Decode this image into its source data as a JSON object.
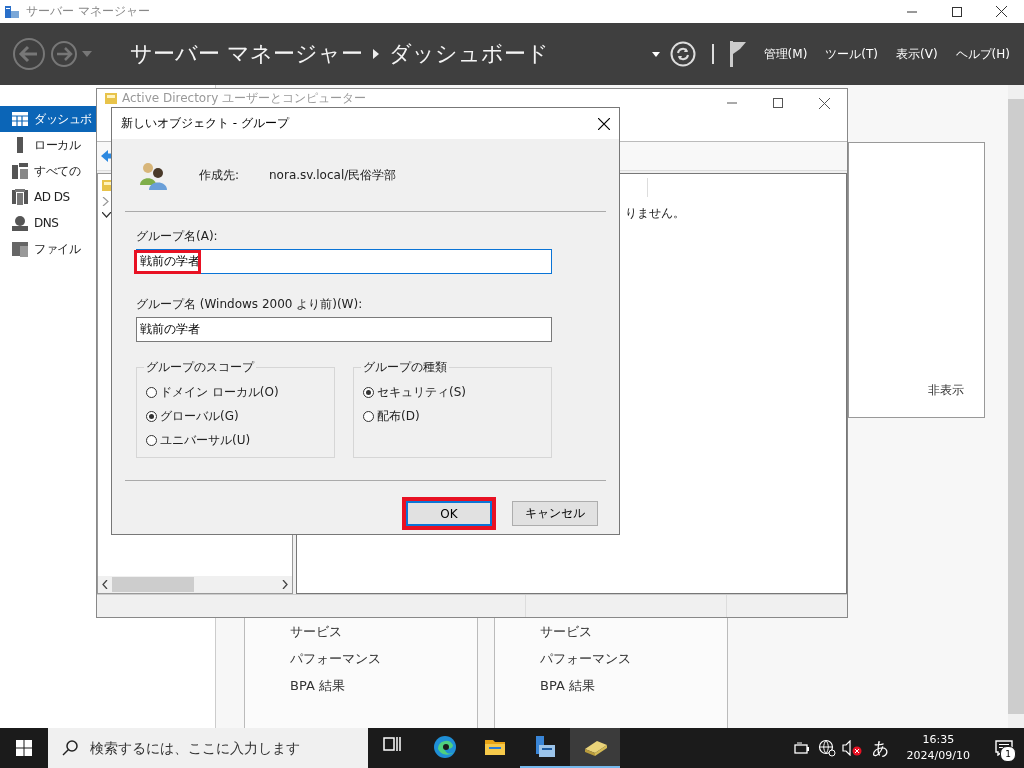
{
  "title_bar": {
    "title": "サーバー マネージャー"
  },
  "header": {
    "breadcrumb": [
      "サーバー マネージャー",
      "ダッシュボード"
    ],
    "menus": [
      "管理(M)",
      "ツール(T)",
      "表示(V)",
      "ヘルプ(H)"
    ]
  },
  "sidebar": {
    "items": [
      {
        "kind": "dashboard",
        "label": "ダッシュボ",
        "selected": true
      },
      {
        "kind": "local",
        "label": "ローカル",
        "selected": false
      },
      {
        "kind": "all",
        "label": "すべての",
        "selected": false
      },
      {
        "kind": "adds",
        "label": "AD DS",
        "selected": false
      },
      {
        "kind": "dns",
        "label": "DNS",
        "selected": false
      },
      {
        "kind": "file",
        "label": "ファイル",
        "selected": false
      }
    ]
  },
  "tiles": [
    {
      "links": [
        "サービス",
        "パフォーマンス",
        "BPA 結果"
      ]
    },
    {
      "links": [
        "サービス",
        "パフォーマンス",
        "BPA 結果"
      ]
    }
  ],
  "side_panel": {
    "hide_link": "非表示"
  },
  "ad_window": {
    "title": "Active Directory ユーザーとコンピューター",
    "message": "りません。"
  },
  "dialog": {
    "title": "新しいオブジェクト - グループ",
    "location_label": "作成先:",
    "location": "nora.sv.local/民俗学部",
    "fields": [
      {
        "label": "グループ名(A):",
        "value": "戦前の学者",
        "highlighted": true,
        "focused": true
      },
      {
        "label": "グループ名 (Windows 2000 より前)(W):",
        "value": "戦前の学者",
        "highlighted": false,
        "focused": false
      }
    ],
    "groups": [
      {
        "title": "グループのスコープ",
        "options": [
          {
            "label": "ドメイン ローカル(O)",
            "selected": false
          },
          {
            "label": "グローバル(G)",
            "selected": true
          },
          {
            "label": "ユニバーサル(U)",
            "selected": false
          }
        ]
      },
      {
        "title": "グループの種類",
        "options": [
          {
            "label": "セキュリティ(S)",
            "selected": true
          },
          {
            "label": "配布(D)",
            "selected": false
          }
        ]
      }
    ],
    "buttons": [
      {
        "label": "OK",
        "default": true,
        "highlighted": true
      },
      {
        "label": "キャンセル",
        "default": false,
        "highlighted": false
      }
    ]
  },
  "taskbar": {
    "search_placeholder": "検索するには、ここに入力します",
    "apps": [
      {
        "kind": "taskview",
        "running": false,
        "selected": false
      },
      {
        "kind": "browser",
        "running": false,
        "selected": false
      },
      {
        "kind": "explorer",
        "running": false,
        "selected": false
      },
      {
        "kind": "servermanager",
        "running": true,
        "selected": false
      },
      {
        "kind": "directory",
        "running": true,
        "selected": true
      }
    ],
    "ime": "あ",
    "time": "16:35",
    "date": "2024/09/10",
    "notifications": "1"
  }
}
